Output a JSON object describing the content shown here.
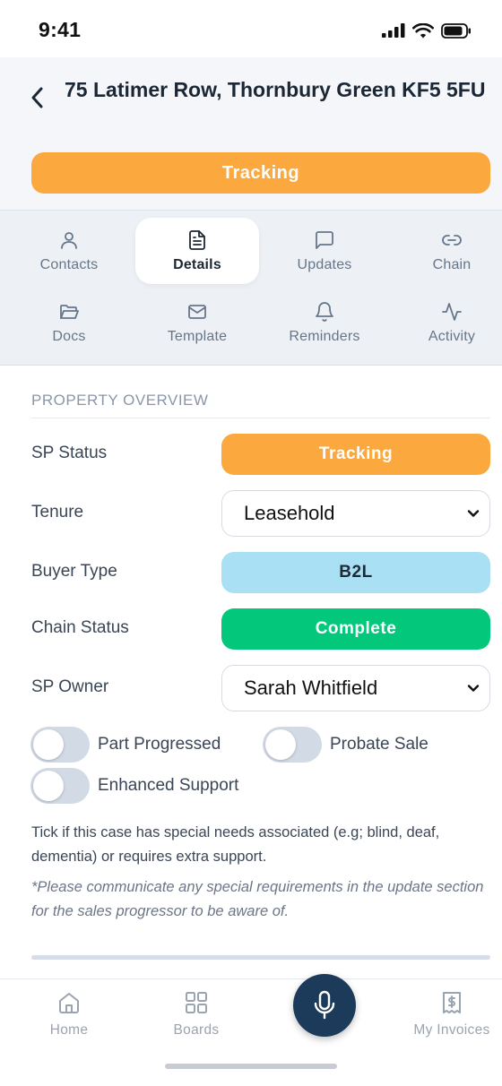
{
  "status_bar": {
    "time": "9:41"
  },
  "header": {
    "address": "75 Latimer Row, Thornbury Green KF5 5FU",
    "status": "Tracking",
    "status_color": "#fba83e"
  },
  "tabs": [
    {
      "label": "Contacts",
      "icon": "person-icon",
      "active": false
    },
    {
      "label": "Details",
      "icon": "document-icon",
      "active": true
    },
    {
      "label": "Updates",
      "icon": "message-icon",
      "active": false
    },
    {
      "label": "Chain",
      "icon": "link-icon",
      "active": false
    },
    {
      "label": "Docs",
      "icon": "folder-icon",
      "active": false
    },
    {
      "label": "Template",
      "icon": "mail-icon",
      "active": false
    },
    {
      "label": "Reminders",
      "icon": "bell-icon",
      "active": false
    },
    {
      "label": "Activity",
      "icon": "activity-icon",
      "active": false
    }
  ],
  "overview": {
    "section_title": "PROPERTY OVERVIEW",
    "sp_status": {
      "label": "SP Status",
      "value": "Tracking",
      "color": "#fba83e"
    },
    "tenure": {
      "label": "Tenure",
      "value": "Leasehold"
    },
    "buyer_type": {
      "label": "Buyer Type",
      "value": "B2L",
      "color": "#a9e0f3"
    },
    "chain_status": {
      "label": "Chain Status",
      "value": "Complete",
      "color": "#03c77b"
    },
    "sp_owner": {
      "label": "SP Owner",
      "value": "Sarah Whitfield"
    }
  },
  "toggles": {
    "part_progressed": {
      "label": "Part Progressed",
      "on": false
    },
    "probate_sale": {
      "label": "Probate Sale",
      "on": false
    },
    "enhanced_support": {
      "label": "Enhanced Support",
      "on": false
    }
  },
  "help_text": "Tick if this case has special needs associated (e.g; blind, deaf, dementia) or requires extra support.",
  "note_text": "*Please communicate any special requirements in the update section for the sales progressor to be aware of.",
  "bottom_nav": {
    "home": "Home",
    "boards": "Boards",
    "invoices": "My Invoices"
  }
}
